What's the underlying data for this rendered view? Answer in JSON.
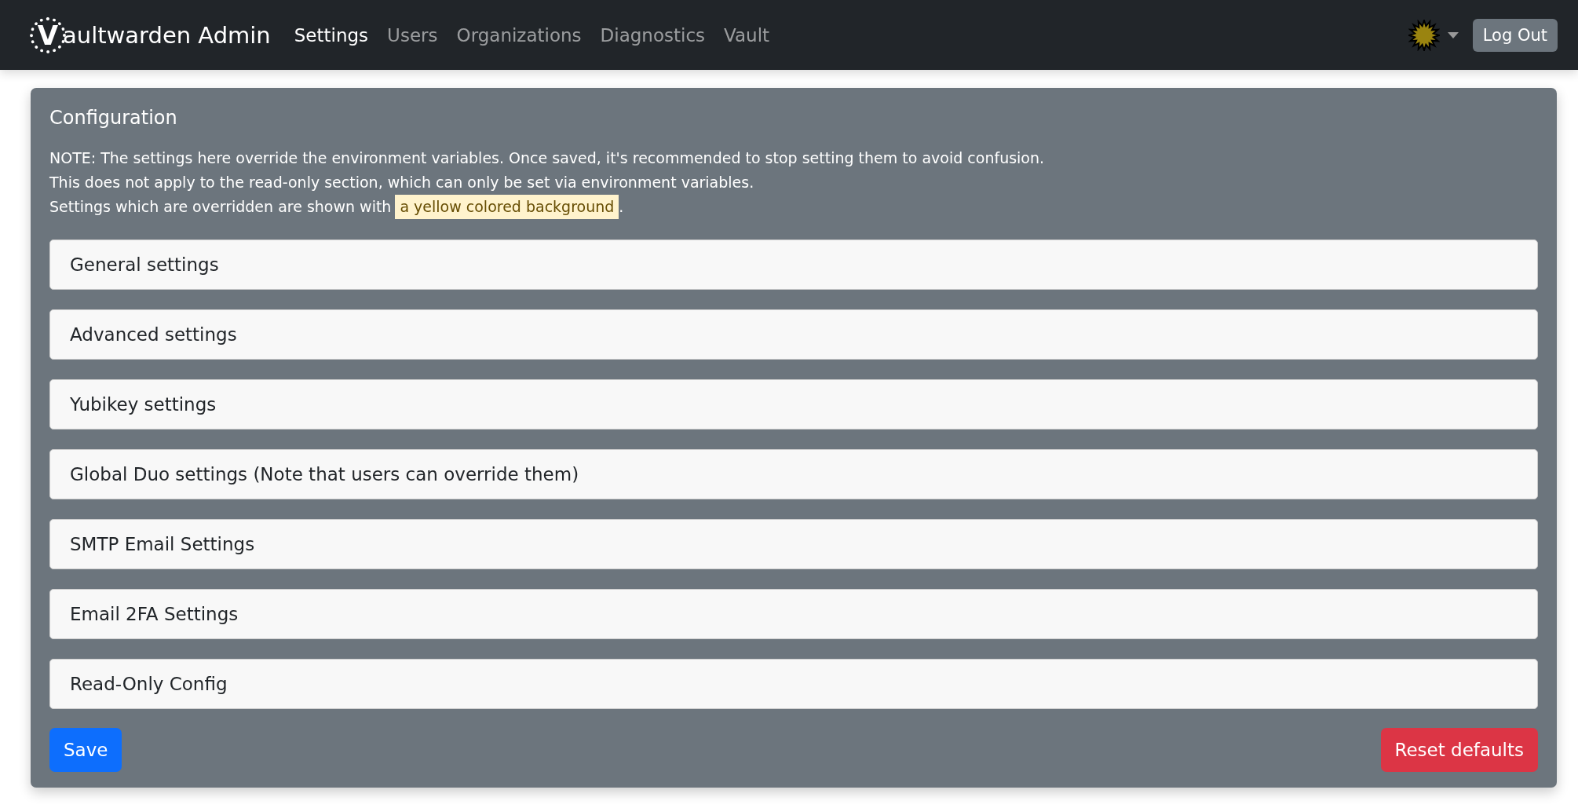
{
  "navbar": {
    "brand_letter": "V",
    "brand": "aultwarden Admin",
    "items": [
      {
        "label": "Settings",
        "selected": true
      },
      {
        "label": "Users",
        "selected": false
      },
      {
        "label": "Organizations",
        "selected": false
      },
      {
        "label": "Diagnostics",
        "selected": false
      },
      {
        "label": "Vault",
        "selected": false
      }
    ],
    "logout": "Log Out"
  },
  "card": {
    "title": "Configuration",
    "notes": [
      "NOTE: The settings here override the environment variables. Once saved, it's recommended to stop setting them to avoid confusion.",
      "This does not apply to the read-only section, which can only be set via environment variables."
    ],
    "override_note": {
      "before": "Settings which are overridden are shown with",
      "highlight": "a yellow colored background",
      "after": "."
    },
    "sections": [
      {
        "label": "General settings",
        "expanded": false
      },
      {
        "label": "Advanced settings",
        "expanded": false
      },
      {
        "label": "Yubikey settings",
        "expanded": false
      },
      {
        "label": "Global Duo settings (Note that users can override them)",
        "expanded": false
      },
      {
        "label": "SMTP Email Settings",
        "expanded": false
      },
      {
        "label": "Email 2FA Settings",
        "expanded": false
      },
      {
        "label": "Read-Only Config",
        "expanded": false
      }
    ],
    "save": "Save",
    "reset": "Reset defaults"
  }
}
